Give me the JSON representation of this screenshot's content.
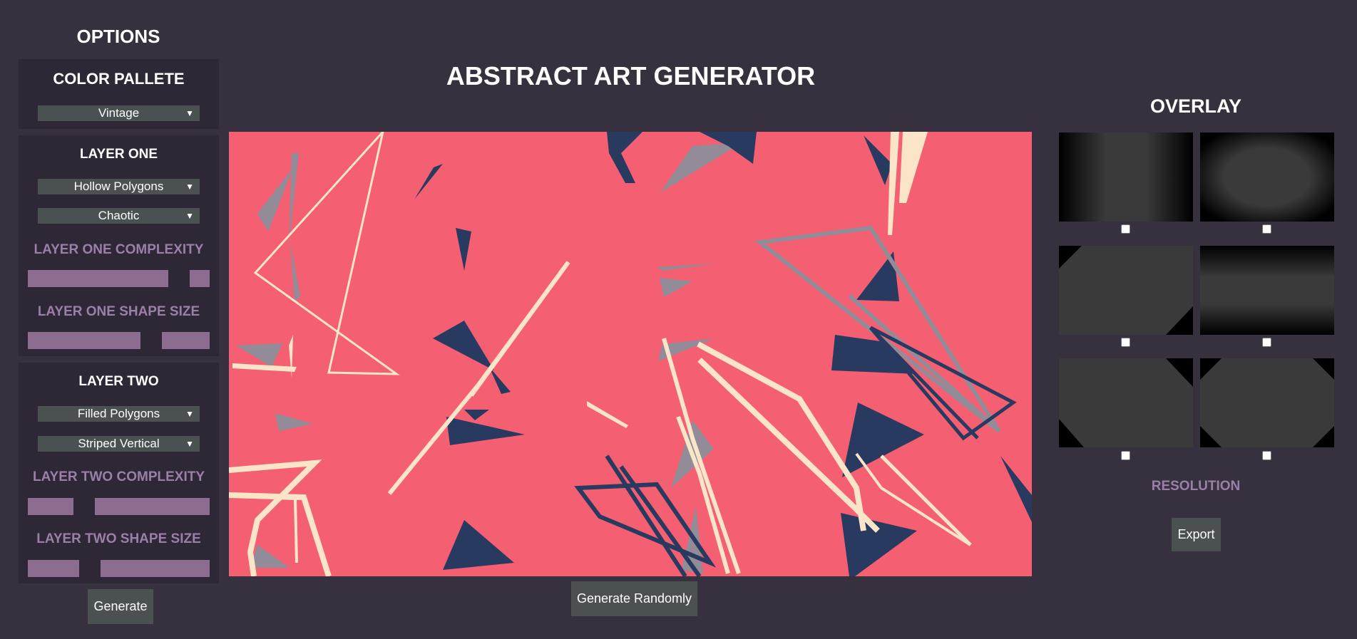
{
  "sidebar": {
    "title": "OPTIONS",
    "palette": {
      "title": "COLOR PALLETE",
      "select": "Vintage"
    },
    "layer_one": {
      "title": "LAYER ONE",
      "shape_select": "Hollow Polygons",
      "pattern_select": "Chaotic",
      "complexity_label": "LAYER ONE COMPLEXITY",
      "complexity_value": 0.83,
      "size_label": "LAYER ONE SHAPE SIZE",
      "size_value": 0.68
    },
    "layer_two": {
      "title": "LAYER TWO",
      "shape_select": "Filled Polygons",
      "pattern_select": "Striped Vertical",
      "complexity_label": "LAYER TWO COMPLEXITY",
      "complexity_value": 0.31,
      "size_label": "LAYER TWO SHAPE SIZE",
      "size_value": 0.34
    },
    "generate_label": "Generate"
  },
  "main": {
    "title": "ABSTRACT ART GENERATOR",
    "generate_random_label": "Generate Randomly",
    "colors": {
      "background": "#f55f72",
      "navy": "#293a61",
      "cream": "#fbe5c8",
      "gray": "#928c99"
    }
  },
  "overlay": {
    "title": "OVERLAY",
    "options": [
      {
        "name": "side-vignette",
        "checked": false
      },
      {
        "name": "oval-vignette",
        "checked": false
      },
      {
        "name": "diagonal-corners",
        "checked": false
      },
      {
        "name": "top-bottom-vignette",
        "checked": false
      },
      {
        "name": "bottom-corners",
        "checked": false
      },
      {
        "name": "four-corners",
        "checked": false
      }
    ],
    "resolution_label": "RESOLUTION",
    "export_label": "Export"
  }
}
